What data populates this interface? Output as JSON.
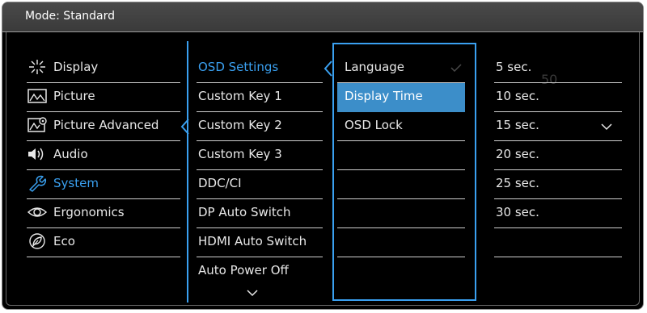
{
  "header": {
    "title": "Mode: Standard"
  },
  "main_menu": {
    "items": [
      {
        "label": "Display",
        "icon": "display-icon"
      },
      {
        "label": "Picture",
        "icon": "picture-icon"
      },
      {
        "label": "Picture Advanced",
        "icon": "picture-advanced-icon"
      },
      {
        "label": "Audio",
        "icon": "audio-icon"
      },
      {
        "label": "System",
        "icon": "system-wrench-icon",
        "active": true
      },
      {
        "label": "Ergonomics",
        "icon": "eye-icon"
      },
      {
        "label": "Eco",
        "icon": "leaf-icon"
      }
    ]
  },
  "system_menu": {
    "items": [
      {
        "label": "OSD Settings",
        "active": true
      },
      {
        "label": "Custom Key 1"
      },
      {
        "label": "Custom Key 2"
      },
      {
        "label": "Custom Key 3"
      },
      {
        "label": "DDC/CI"
      },
      {
        "label": "DP Auto Switch"
      },
      {
        "label": "HDMI Auto Switch"
      },
      {
        "label": "Auto Power Off"
      }
    ]
  },
  "osd_menu": {
    "items": [
      {
        "label": "Language"
      },
      {
        "label": "Display Time",
        "selected": true
      },
      {
        "label": "OSD Lock"
      }
    ]
  },
  "display_time_options": {
    "items": [
      {
        "label": "5 sec."
      },
      {
        "label": "10 sec."
      },
      {
        "label": "15 sec.",
        "checked": true
      },
      {
        "label": "20 sec."
      },
      {
        "label": "25 sec."
      },
      {
        "label": "30 sec."
      }
    ],
    "ghost_value": "50"
  },
  "colors": {
    "accent": "#3aa0f0",
    "selected_bg": "#3c8ec9",
    "background": "#000000"
  }
}
